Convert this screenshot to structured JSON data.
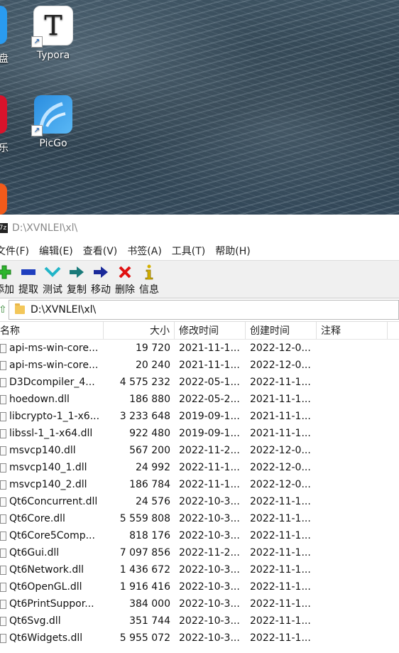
{
  "desktop": {
    "icons": [
      {
        "label": "Typora",
        "symbol": "T"
      },
      {
        "label": "PicGo",
        "symbol": ""
      }
    ],
    "partial_labels": [
      "盘",
      "乐"
    ]
  },
  "window": {
    "title": "D:\\XVNLEI\\xl\\",
    "app_icon_text": "7z"
  },
  "menu": [
    "文件(F)",
    "编辑(E)",
    "查看(V)",
    "书签(A)",
    "工具(T)",
    "帮助(H)"
  ],
  "toolbar": [
    {
      "label": "添加",
      "icon": "add-icon",
      "color": "#2db52d"
    },
    {
      "label": "提取",
      "icon": "extract-icon",
      "color": "#1f3fbf"
    },
    {
      "label": "测试",
      "icon": "test-icon",
      "color": "#22b5c8"
    },
    {
      "label": "复制",
      "icon": "copy-icon",
      "color": "#1a7a7a"
    },
    {
      "label": "移动",
      "icon": "move-icon",
      "color": "#1a2a9a"
    },
    {
      "label": "删除",
      "icon": "delete-icon",
      "color": "#e01010"
    },
    {
      "label": "信息",
      "icon": "info-icon",
      "color": "#d4b000"
    }
  ],
  "address": {
    "path": "D:\\XVNLEI\\xl\\"
  },
  "columns": [
    "名称",
    "大小",
    "修改时间",
    "创建时间",
    "注释"
  ],
  "files": [
    {
      "name": "api-ms-win-core...",
      "size": "19 720",
      "modified": "2021-11-1...",
      "created": "2022-12-0..."
    },
    {
      "name": "api-ms-win-core...",
      "size": "20 240",
      "modified": "2021-11-1...",
      "created": "2022-12-0..."
    },
    {
      "name": "D3Dcompiler_4...",
      "size": "4 575 232",
      "modified": "2022-05-1...",
      "created": "2022-11-1..."
    },
    {
      "name": "hoedown.dll",
      "size": "186 880",
      "modified": "2022-05-2...",
      "created": "2021-11-1..."
    },
    {
      "name": "libcrypto-1_1-x6...",
      "size": "3 233 648",
      "modified": "2019-09-1...",
      "created": "2021-11-1..."
    },
    {
      "name": "libssl-1_1-x64.dll",
      "size": "922 480",
      "modified": "2019-09-1...",
      "created": "2021-11-1..."
    },
    {
      "name": "msvcp140.dll",
      "size": "567 200",
      "modified": "2022-11-2...",
      "created": "2022-12-0..."
    },
    {
      "name": "msvcp140_1.dll",
      "size": "24 992",
      "modified": "2022-11-1...",
      "created": "2022-12-0..."
    },
    {
      "name": "msvcp140_2.dll",
      "size": "186 784",
      "modified": "2022-11-1...",
      "created": "2022-12-0..."
    },
    {
      "name": "Qt6Concurrent.dll",
      "size": "24 576",
      "modified": "2022-10-3...",
      "created": "2022-11-1..."
    },
    {
      "name": "Qt6Core.dll",
      "size": "5 559 808",
      "modified": "2022-10-3...",
      "created": "2022-11-1..."
    },
    {
      "name": "Qt6Core5Comp...",
      "size": "818 176",
      "modified": "2022-10-3...",
      "created": "2022-11-1..."
    },
    {
      "name": "Qt6Gui.dll",
      "size": "7 097 856",
      "modified": "2022-11-2...",
      "created": "2022-11-1..."
    },
    {
      "name": "Qt6Network.dll",
      "size": "1 436 672",
      "modified": "2022-10-3...",
      "created": "2022-11-1..."
    },
    {
      "name": "Qt6OpenGL.dll",
      "size": "1 916 416",
      "modified": "2022-10-3...",
      "created": "2022-11-1..."
    },
    {
      "name": "Qt6PrintSuppor...",
      "size": "384 000",
      "modified": "2022-10-3...",
      "created": "2022-11-1..."
    },
    {
      "name": "Qt6Svg.dll",
      "size": "351 744",
      "modified": "2022-10-3...",
      "created": "2022-11-1..."
    },
    {
      "name": "Qt6Widgets.dll",
      "size": "5 955 072",
      "modified": "2022-10-3...",
      "created": "2022-11-1..."
    }
  ]
}
